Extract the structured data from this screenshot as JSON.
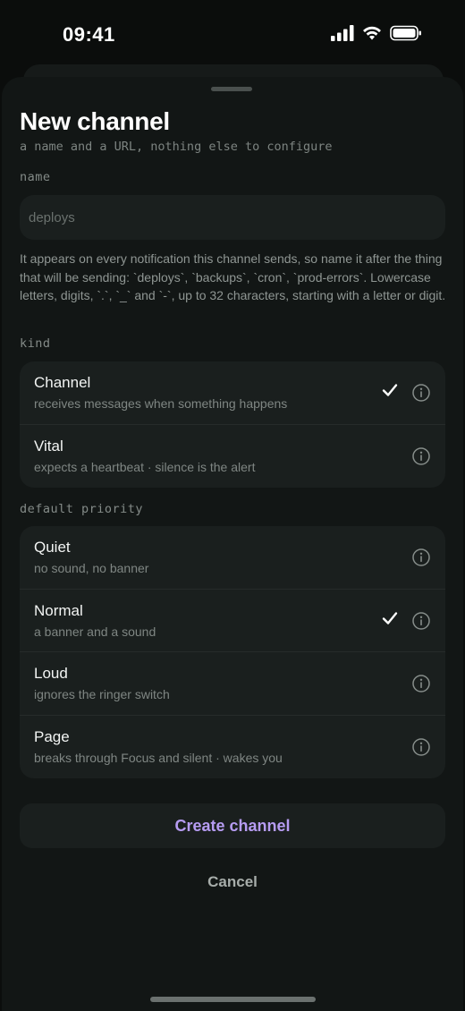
{
  "status_bar": {
    "time": "09:41"
  },
  "sheet": {
    "title": "New channel",
    "subtitle": "a name and a URL, nothing else to configure"
  },
  "name_field": {
    "label": "name",
    "placeholder": "deploys",
    "value": "",
    "help": "It appears on every notification this channel sends, so name it after the thing that will be sending: `deploys`, `backups`, `cron`, `prod-errors`. Lowercase letters, digits, `.`, `_` and `-`, up to 32 characters, starting with a letter or digit."
  },
  "kind": {
    "label": "kind",
    "selected": "Channel",
    "options": [
      {
        "label": "Channel",
        "description": "receives messages when something happens",
        "selected": true,
        "icon": "info-icon"
      },
      {
        "label": "Vital",
        "description": "expects a heartbeat · silence is the alert",
        "selected": false,
        "icon": "info-icon"
      }
    ]
  },
  "priority": {
    "label": "default priority",
    "selected": "Normal",
    "options": [
      {
        "label": "Quiet",
        "description": "no sound, no banner",
        "selected": false,
        "icon": "info-icon"
      },
      {
        "label": "Normal",
        "description": "a banner and a sound",
        "selected": true,
        "icon": "info-icon"
      },
      {
        "label": "Loud",
        "description": "ignores the ringer switch",
        "selected": false,
        "icon": "info-icon"
      },
      {
        "label": "Page",
        "description": "breaks through Focus and silent · wakes you",
        "selected": false,
        "icon": "info-icon"
      }
    ]
  },
  "actions": {
    "create_label": "Create channel",
    "cancel_label": "Cancel"
  },
  "colors": {
    "background": "#0b0d0c",
    "sheet": "#121615",
    "card": "#1a1f1e",
    "accent": "#b69cf2"
  }
}
